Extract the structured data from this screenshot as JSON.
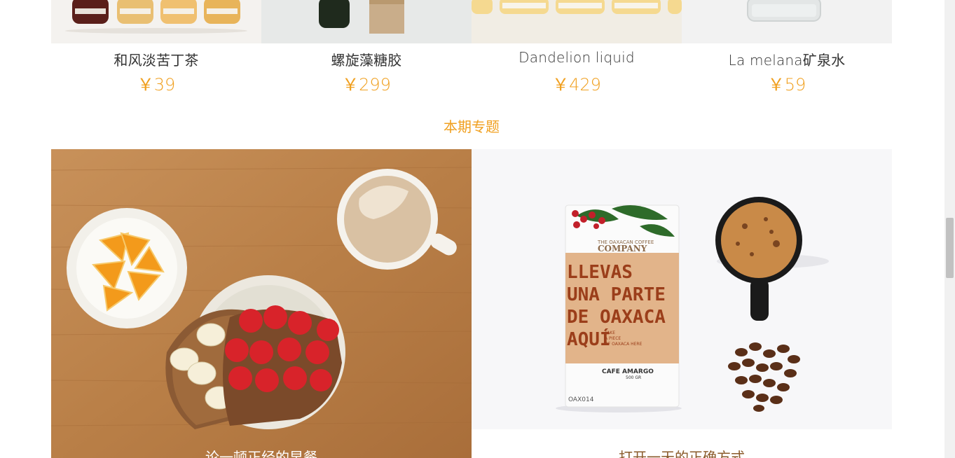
{
  "products": [
    {
      "name": "和风淡苦丁茶",
      "price": "￥39"
    },
    {
      "name": "螺旋藻糖胶",
      "price": "￥299"
    },
    {
      "name": "Dandelion liquid",
      "price": "￥429"
    },
    {
      "name": "La melana矿泉水",
      "price": "￥59"
    }
  ],
  "section": {
    "title": "本期专题"
  },
  "topics": [
    {
      "caption": "论一顿正经的早餐"
    },
    {
      "caption": "打开一天的正确方式",
      "package": {
        "brand_small": "THE OAXACAN COFFEE",
        "brand": "COMPANY",
        "line1": "LLEVAS",
        "line2": "UNA PARTE",
        "line3": "DE OAXACA",
        "line4": "AQUÍ",
        "side_note_1": "TAKE",
        "side_note_2": "A PIECE",
        "side_note_3": "OF OAXACA HERE",
        "product": "CAFE AMARGO",
        "weight": "500 GR",
        "code": "OAX014"
      }
    }
  ],
  "colors": {
    "accent": "#f0a020",
    "text": "#333333",
    "caption_brown": "#8a5a2a"
  }
}
